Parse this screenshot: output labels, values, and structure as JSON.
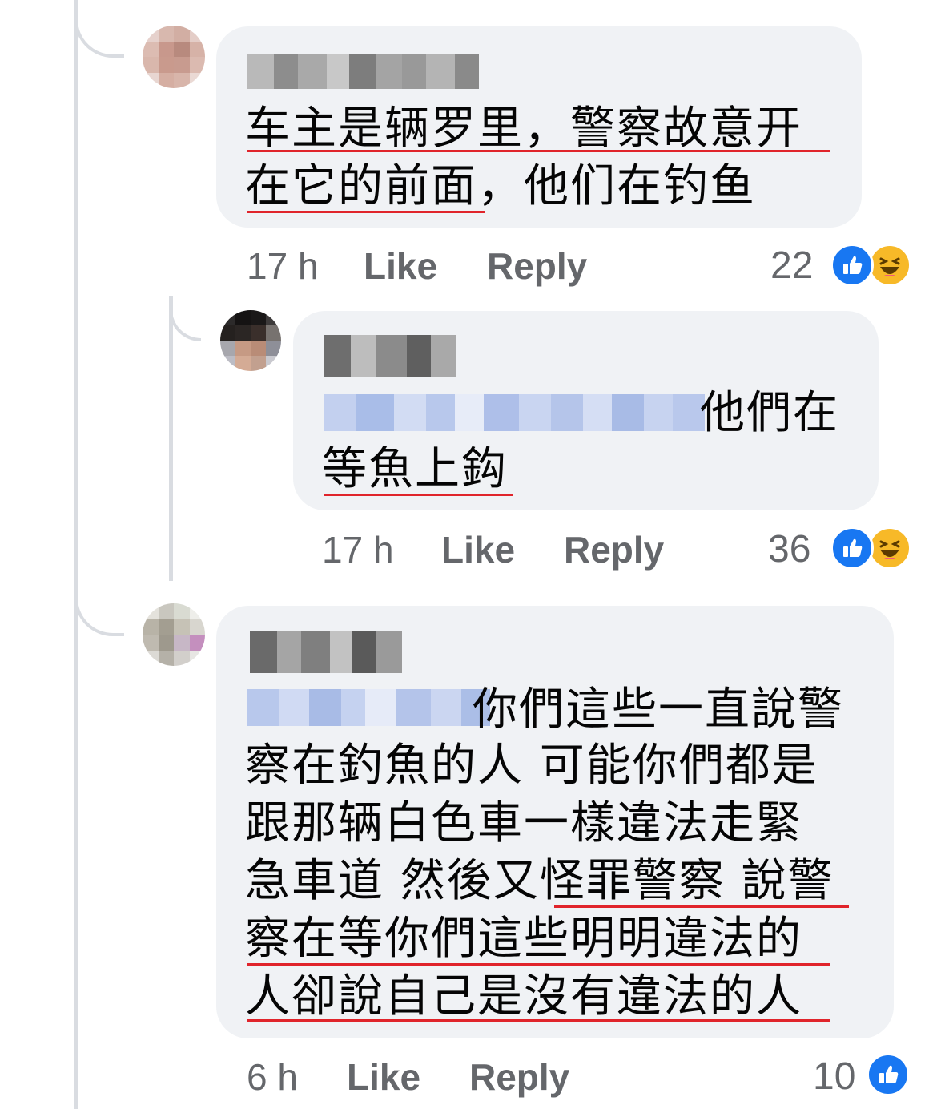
{
  "comments": [
    {
      "author_name": "Yap Jerk",
      "text_lines": [
        "车主是辆罗里，警察故意开",
        "在它的前面，他们在钓鱼"
      ],
      "time": "17 h",
      "like_label": "Like",
      "reply_label": "Reply",
      "reaction_count": "22",
      "reactions": [
        "like-icon",
        "haha-icon"
      ]
    },
    {
      "author_name": "",
      "mention": "Chan Thing Wa",
      "text_lines": [
        "他們在",
        "等魚上鈎"
      ],
      "time": "17 h",
      "like_label": "Like",
      "reply_label": "Reply",
      "reaction_count": "36",
      "reactions": [
        "like-icon",
        "haha-icon"
      ]
    },
    {
      "author_name": "",
      "mention": "Tang Tean",
      "text_lines": [
        "你們這些一直說警",
        "察在釣魚的人 可能你們都是",
        "跟那辆白色車一樣違法走緊",
        "急車道 然後又怪罪警察 說警",
        "察在等你們這些明明違法的",
        "人卻說自己是沒有違法的人"
      ],
      "time": "6 h",
      "like_label": "Like",
      "reply_label": "Reply",
      "reaction_count": "10",
      "reactions": [
        "like-icon"
      ]
    }
  ],
  "colors": {
    "bubble": "#f0f2f5",
    "meta_text": "#65676b",
    "underline": "#e0242b",
    "like_blue": "#1877f2",
    "haha_yellow": "#f7b928"
  }
}
